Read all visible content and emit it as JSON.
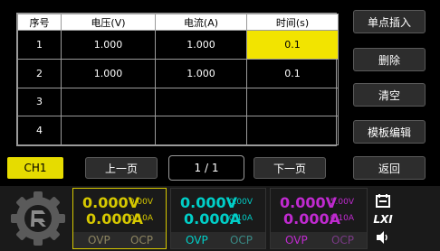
{
  "table": {
    "headers": [
      "序号",
      "电压(V)",
      "电流(A)",
      "时间(s)"
    ],
    "rows": [
      {
        "idx": "1",
        "voltage": "1.000",
        "current": "1.000",
        "time": "0.1"
      },
      {
        "idx": "2",
        "voltage": "1.000",
        "current": "1.000",
        "time": "0.1"
      },
      {
        "idx": "3",
        "voltage": "",
        "current": "",
        "time": ""
      },
      {
        "idx": "4",
        "voltage": "",
        "current": "",
        "time": ""
      }
    ]
  },
  "side_buttons": {
    "insert": "单点插入",
    "delete": "删除",
    "clear": "清空",
    "template": "模板编辑",
    "back": "返回"
  },
  "nav": {
    "channel": "CH1",
    "prev": "上一页",
    "page": "1 / 1",
    "next": "下一页"
  },
  "channels": [
    {
      "voltage": "0.000V",
      "voltage_set": "0.00V",
      "current": "0.000A",
      "current_set": "0.10A",
      "ovp": "OVP",
      "ocp": "OCP",
      "color": "#d6c800"
    },
    {
      "voltage": "0.000V",
      "voltage_set": "0.00V",
      "current": "0.000A",
      "current_set": "0.10A",
      "ovp": "OVP",
      "ocp": "OCP",
      "color": "#00cfc8"
    },
    {
      "voltage": "0.000V",
      "voltage_set": "5.00V",
      "current": "0.000A",
      "current_set": "0.10A",
      "ovp": "OVP",
      "ocp": "OCP",
      "color": "#c02ad0"
    }
  ],
  "status_icons": {
    "lxi": "LXI"
  }
}
